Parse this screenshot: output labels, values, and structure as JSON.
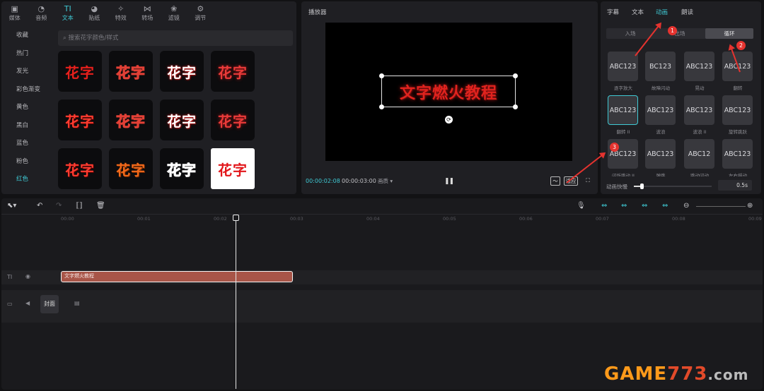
{
  "left_panel": {
    "tabs": [
      {
        "icon": "media-icon",
        "glyph": "▣",
        "label": "媒体"
      },
      {
        "icon": "audio-icon",
        "glyph": "◔",
        "label": "音频"
      },
      {
        "icon": "text-icon",
        "glyph": "TI",
        "label": "文本"
      },
      {
        "icon": "sticker-icon",
        "glyph": "◕",
        "label": "贴纸"
      },
      {
        "icon": "effects-icon",
        "glyph": "✧",
        "label": "特效"
      },
      {
        "icon": "transition-icon",
        "glyph": "⋈",
        "label": "转场"
      },
      {
        "icon": "filter-icon",
        "glyph": "❀",
        "label": "滤镜"
      },
      {
        "icon": "adjust-icon",
        "glyph": "⚙",
        "label": "调节"
      }
    ],
    "categories": [
      "收藏",
      "热门",
      "发光",
      "彩色渐变",
      "黄色",
      "黑白",
      "蓝色",
      "粉色",
      "红色"
    ],
    "search_placeholder": "搜索花字颜色/样式",
    "tile_text": "花字"
  },
  "player": {
    "title": "播放器",
    "canvas_text": "文字燃火教程",
    "current_time": "00:00:02:08",
    "total_time": "00:00:03:00",
    "quality": "画质 ▾",
    "pause_glyph": "❚❚",
    "fit_label": "适应"
  },
  "right_panel": {
    "tabs": [
      "字幕",
      "文本",
      "动画",
      "朗读"
    ],
    "anim_segments": [
      "入场",
      "出场",
      "循环"
    ],
    "anim_items": [
      {
        "text": "ABC123",
        "label": "逐字放大"
      },
      {
        "text": "BC123",
        "label": "故障闪动"
      },
      {
        "text": "ABC123",
        "label": "晃动"
      },
      {
        "text": "ABC123",
        "label": "翻转"
      },
      {
        "text": "ABC123",
        "label": "翻转 II"
      },
      {
        "text": "ABC123",
        "label": "波浪"
      },
      {
        "text": "ABC123",
        "label": "波浪 II"
      },
      {
        "text": "ABC123",
        "label": "旋转跳跃"
      },
      {
        "text": "ABC123",
        "label": "闪烁跳动 II"
      },
      {
        "text": "ABC123",
        "label": "弹跳"
      },
      {
        "text": "ABC12",
        "label": "跳动闪动"
      },
      {
        "text": "ABC123",
        "label": "左右摇动"
      }
    ],
    "speed_label": "动画快慢",
    "speed_value": 0.1,
    "speed_value_text": "0.5s",
    "annotations": [
      "1",
      "2",
      "3"
    ]
  },
  "timeline": {
    "ruler": [
      "00:00",
      "00:01",
      "00:02",
      "00:03",
      "00:04",
      "00:05",
      "00:06",
      "00:07",
      "00:08",
      "00:09"
    ],
    "text_clip_label": "文字燃火教程",
    "cover_label": "封面",
    "track_text_icon": "TI"
  },
  "watermark": {
    "main": "GAME",
    "num": "773",
    "suffix": ".com"
  }
}
